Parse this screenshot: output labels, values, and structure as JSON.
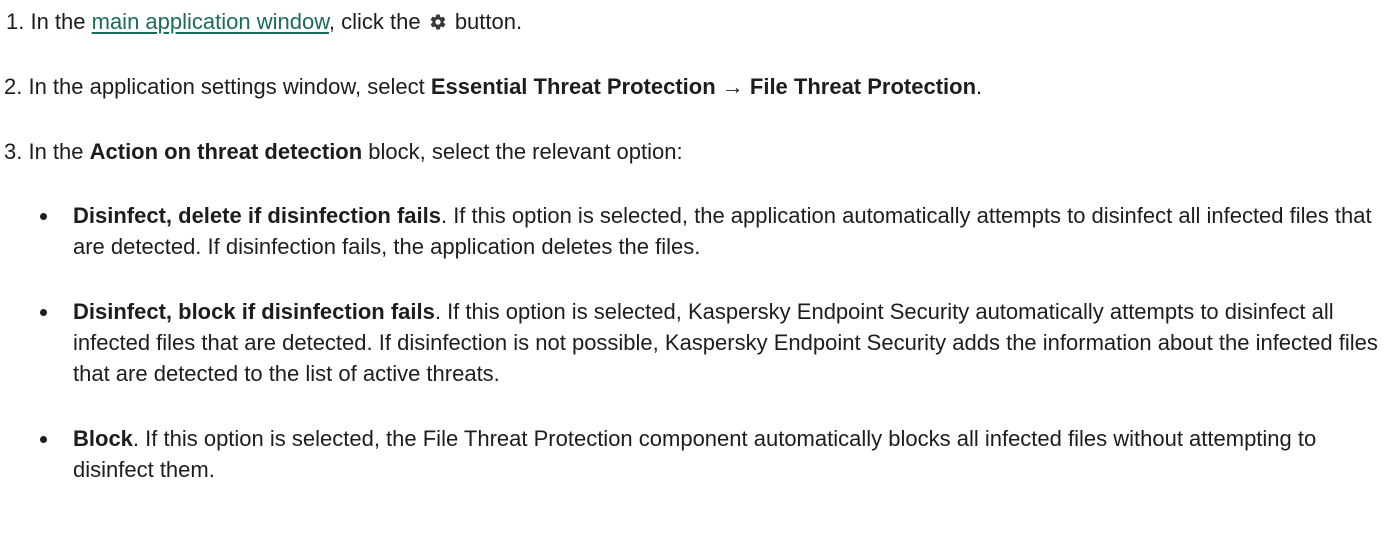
{
  "steps": {
    "step1": {
      "prefix": "1. In the ",
      "link": "main application window",
      "middle": ", click the ",
      "icon": "gear-icon",
      "suffix": " button."
    },
    "step2": {
      "prefix": "2. In the application settings window, select ",
      "bold": "Essential Threat Protection → File Threat Protection",
      "suffix": "."
    },
    "step3": {
      "prefix": "3. In the ",
      "bold": "Action on threat detection",
      "suffix": " block, select the relevant option:"
    }
  },
  "options": [
    {
      "title": "Disinfect, delete if disinfection fails",
      "text": ". If this option is selected, the application automatically attempts to disinfect all infected files that are detected. If disinfection fails, the application deletes the files."
    },
    {
      "title": "Disinfect, block if disinfection fails",
      "text": ". If this option is selected, Kaspersky Endpoint Security automatically attempts to disinfect all infected files that are detected. If disinfection is not possible, Kaspersky Endpoint Security adds the information about the infected files that are detected to the list of active threats."
    },
    {
      "title": "Block",
      "text": ". If this option is selected, the File Threat Protection component automatically blocks all infected files without attempting to disinfect them."
    }
  ]
}
